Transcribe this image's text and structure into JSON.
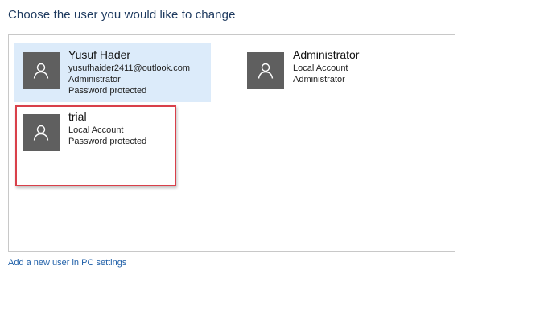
{
  "page": {
    "title": "Choose the user you would like to change"
  },
  "users": [
    {
      "name": "Yusuf Hader",
      "lines": [
        "yusufhaider2411@outlook.com",
        "Administrator",
        "Password protected"
      ],
      "selected": true,
      "avatar_icon": "user-silhouette-icon"
    },
    {
      "name": "Administrator",
      "lines": [
        "Local Account",
        "Administrator"
      ],
      "selected": false,
      "avatar_icon": "user-silhouette-icon"
    },
    {
      "name": "trial",
      "lines": [
        "Local Account",
        "Password protected"
      ],
      "selected": false,
      "avatar_icon": "user-silhouette-icon"
    }
  ],
  "footer": {
    "add_user_link": "Add a new user in PC settings"
  },
  "colors": {
    "title": "#1e3a5f",
    "selected_tile": "#dcebfa",
    "avatar_bg": "#5f5f5f",
    "highlight_border": "#d9404a",
    "link": "#1f5fa8"
  }
}
